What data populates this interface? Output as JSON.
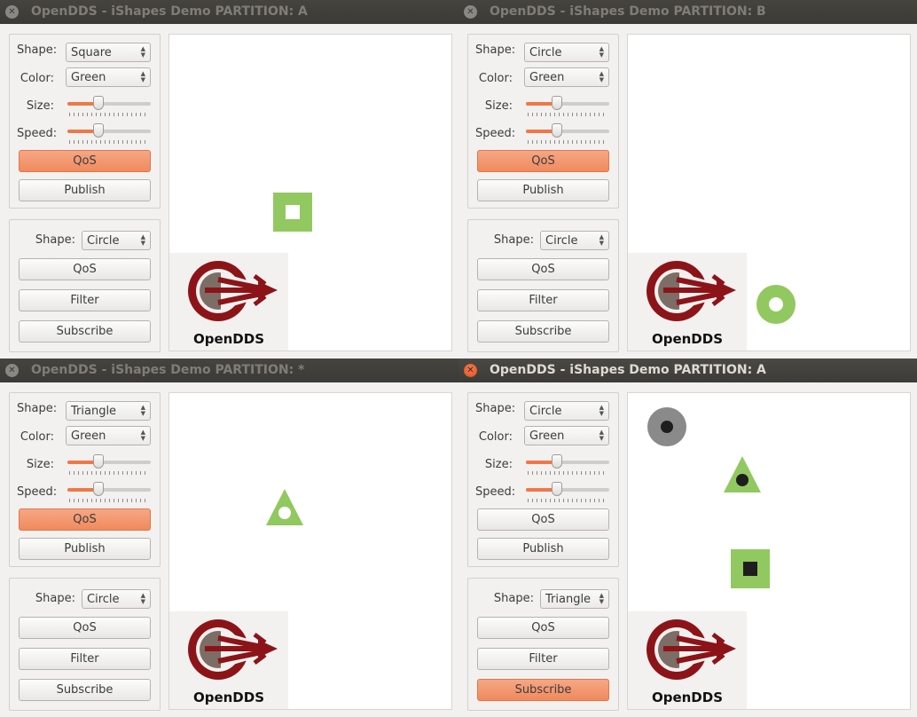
{
  "labels": {
    "shape": "Shape:",
    "color": "Color:",
    "size": "Size:",
    "speed": "Speed:"
  },
  "buttons": {
    "qos": "QoS",
    "publish": "Publish",
    "filter": "Filter",
    "subscribe": "Subscribe"
  },
  "logo_text": "OpenDDS",
  "colors": {
    "green": "#92c860",
    "accent": "#f08a5d",
    "gray": "#8a8a8a"
  },
  "windows": [
    {
      "title": "OpenDDS - iShapes Demo PARTITION: A",
      "active": false,
      "publisher": {
        "shape": "Square",
        "color": "Green",
        "size_level": 0.37,
        "speed_level": 0.37
      },
      "subscriber": {
        "shape": "Circle"
      },
      "highlighted": "pub-qos"
    },
    {
      "title": "OpenDDS - iShapes Demo PARTITION: B",
      "active": false,
      "publisher": {
        "shape": "Circle",
        "color": "Green",
        "size_level": 0.37,
        "speed_level": 0.37
      },
      "subscriber": {
        "shape": "Circle"
      },
      "highlighted": "pub-qos"
    },
    {
      "title": "OpenDDS - iShapes Demo PARTITION: *",
      "active": false,
      "publisher": {
        "shape": "Triangle",
        "color": "Green",
        "size_level": 0.37,
        "speed_level": 0.37
      },
      "subscriber": {
        "shape": "Circle"
      },
      "highlighted": "pub-qos"
    },
    {
      "title": "OpenDDS - iShapes Demo PARTITION: A",
      "active": true,
      "publisher": {
        "shape": "Circle",
        "color": "Green",
        "size_level": 0.37,
        "speed_level": 0.37
      },
      "subscriber": {
        "shape": "Triangle"
      },
      "highlighted": "subscribe"
    }
  ]
}
